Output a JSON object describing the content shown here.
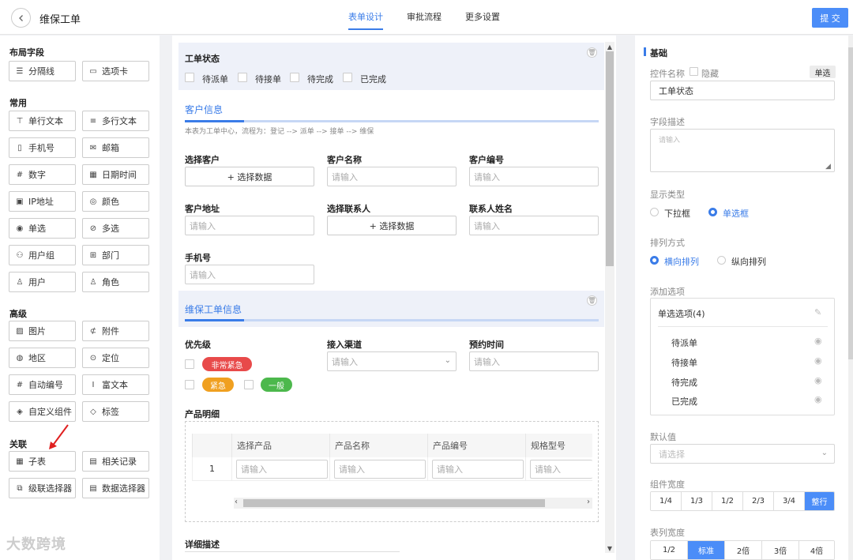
{
  "header": {
    "back_icon": "chevron-left-icon",
    "title": "维保工单",
    "tabs": [
      "表单设计",
      "审批流程",
      "更多设置"
    ],
    "submit": "提 交"
  },
  "palette": {
    "sections": [
      "布局字段",
      "常用",
      "高级",
      "关联"
    ],
    "layout": [
      {
        "label": "分隔线",
        "icon": "divider-icon"
      },
      {
        "label": "选项卡",
        "icon": "tab-icon"
      }
    ],
    "common": [
      {
        "label": "单行文本",
        "icon": "single-text-icon"
      },
      {
        "label": "多行文本",
        "icon": "multi-text-icon"
      },
      {
        "label": "手机号",
        "icon": "phone-icon"
      },
      {
        "label": "邮箱",
        "icon": "mail-icon"
      },
      {
        "label": "数字",
        "icon": "number-icon"
      },
      {
        "label": "日期时间",
        "icon": "calendar-icon"
      },
      {
        "label": "IP地址",
        "icon": "ip-icon"
      },
      {
        "label": "颜色",
        "icon": "palette-icon"
      },
      {
        "label": "单选",
        "icon": "radio-icon"
      },
      {
        "label": "多选",
        "icon": "checkbox-icon"
      },
      {
        "label": "用户组",
        "icon": "user-group-icon"
      },
      {
        "label": "部门",
        "icon": "department-icon"
      },
      {
        "label": "用户",
        "icon": "user-icon"
      },
      {
        "label": "角色",
        "icon": "role-icon"
      }
    ],
    "advanced": [
      {
        "label": "图片",
        "icon": "image-icon"
      },
      {
        "label": "附件",
        "icon": "attachment-icon"
      },
      {
        "label": "地区",
        "icon": "location-pin-icon"
      },
      {
        "label": "定位",
        "icon": "crosshair-icon"
      },
      {
        "label": "自动编号",
        "icon": "hash-icon"
      },
      {
        "label": "富文本",
        "icon": "rich-text-icon"
      },
      {
        "label": "自定义组件",
        "icon": "layers-icon"
      },
      {
        "label": "标签",
        "icon": "tag-icon"
      }
    ],
    "relation": [
      {
        "label": "子表",
        "icon": "table-icon"
      },
      {
        "label": "相关记录",
        "icon": "related-records-icon"
      },
      {
        "label": "级联选择器",
        "icon": "cascade-icon"
      },
      {
        "label": "数据选择器",
        "icon": "data-select-icon"
      }
    ],
    "watermark": "大数跨境"
  },
  "form": {
    "status": {
      "label": "工单状态",
      "options": [
        "待派单",
        "待接单",
        "待完成",
        "已完成"
      ]
    },
    "customer_section": {
      "title": "客户信息",
      "desc": "本表为工单中心，流程为：登记 --> 派单 --> 接单 --> 维保",
      "fields": {
        "select_customer": {
          "label": "选择客户",
          "button": "+ 选择数据"
        },
        "customer_name": {
          "label": "客户名称",
          "placeholder": "请输入"
        },
        "customer_no": {
          "label": "客户编号",
          "placeholder": "请输入"
        },
        "customer_address": {
          "label": "客户地址",
          "placeholder": "请输入"
        },
        "select_contact": {
          "label": "选择联系人",
          "button": "+ 选择数据"
        },
        "contact_name": {
          "label": "联系人姓名",
          "placeholder": "请输入"
        },
        "phone": {
          "label": "手机号",
          "placeholder": "请输入"
        }
      }
    },
    "order_section": {
      "title": "维保工单信息",
      "priority": {
        "label": "优先级",
        "tags": [
          {
            "text": "非常紧急",
            "color": "#e84a4a"
          },
          {
            "text": "紧急",
            "color": "#f0a020"
          },
          {
            "text": "一般",
            "color": "#4cb84c"
          }
        ]
      },
      "channel": {
        "label": "接入渠道",
        "placeholder": "请输入"
      },
      "appointment": {
        "label": "预约时间",
        "placeholder": "请输入"
      },
      "products": {
        "label": "产品明细",
        "columns": [
          "选择产品",
          "产品名称",
          "产品编号",
          "规格型号"
        ],
        "row_index": "1",
        "placeholder": "请输入"
      },
      "detail_label": "详细描述"
    }
  },
  "props": {
    "section": "基础",
    "control_name_label": "控件名称",
    "hide_label": "隐藏",
    "type_badge": "单选",
    "control_name_value": "工单状态",
    "field_desc_label": "字段描述",
    "field_desc_placeholder": "请输入",
    "display_type_label": "显示类型",
    "display_types": [
      "下拉框",
      "单选框"
    ],
    "arrange_label": "排列方式",
    "arrange_options": [
      "横向排列",
      "纵向排列"
    ],
    "add_option_label": "添加选项",
    "option_group_title": "单选选项(4)",
    "options": [
      "待派单",
      "待接单",
      "待完成",
      "已完成"
    ],
    "default_label": "默认值",
    "default_placeholder": "请选择",
    "width_label": "组件宽度",
    "widths": [
      "1/4",
      "1/3",
      "1/2",
      "2/3",
      "3/4",
      "整行"
    ],
    "selected_width": "整行",
    "col_width_label": "表列宽度",
    "col_widths": [
      "1/2",
      "标准",
      "2倍",
      "3倍",
      "4倍"
    ],
    "selected_col_width": "标准",
    "accent": "#3a7ce8"
  }
}
